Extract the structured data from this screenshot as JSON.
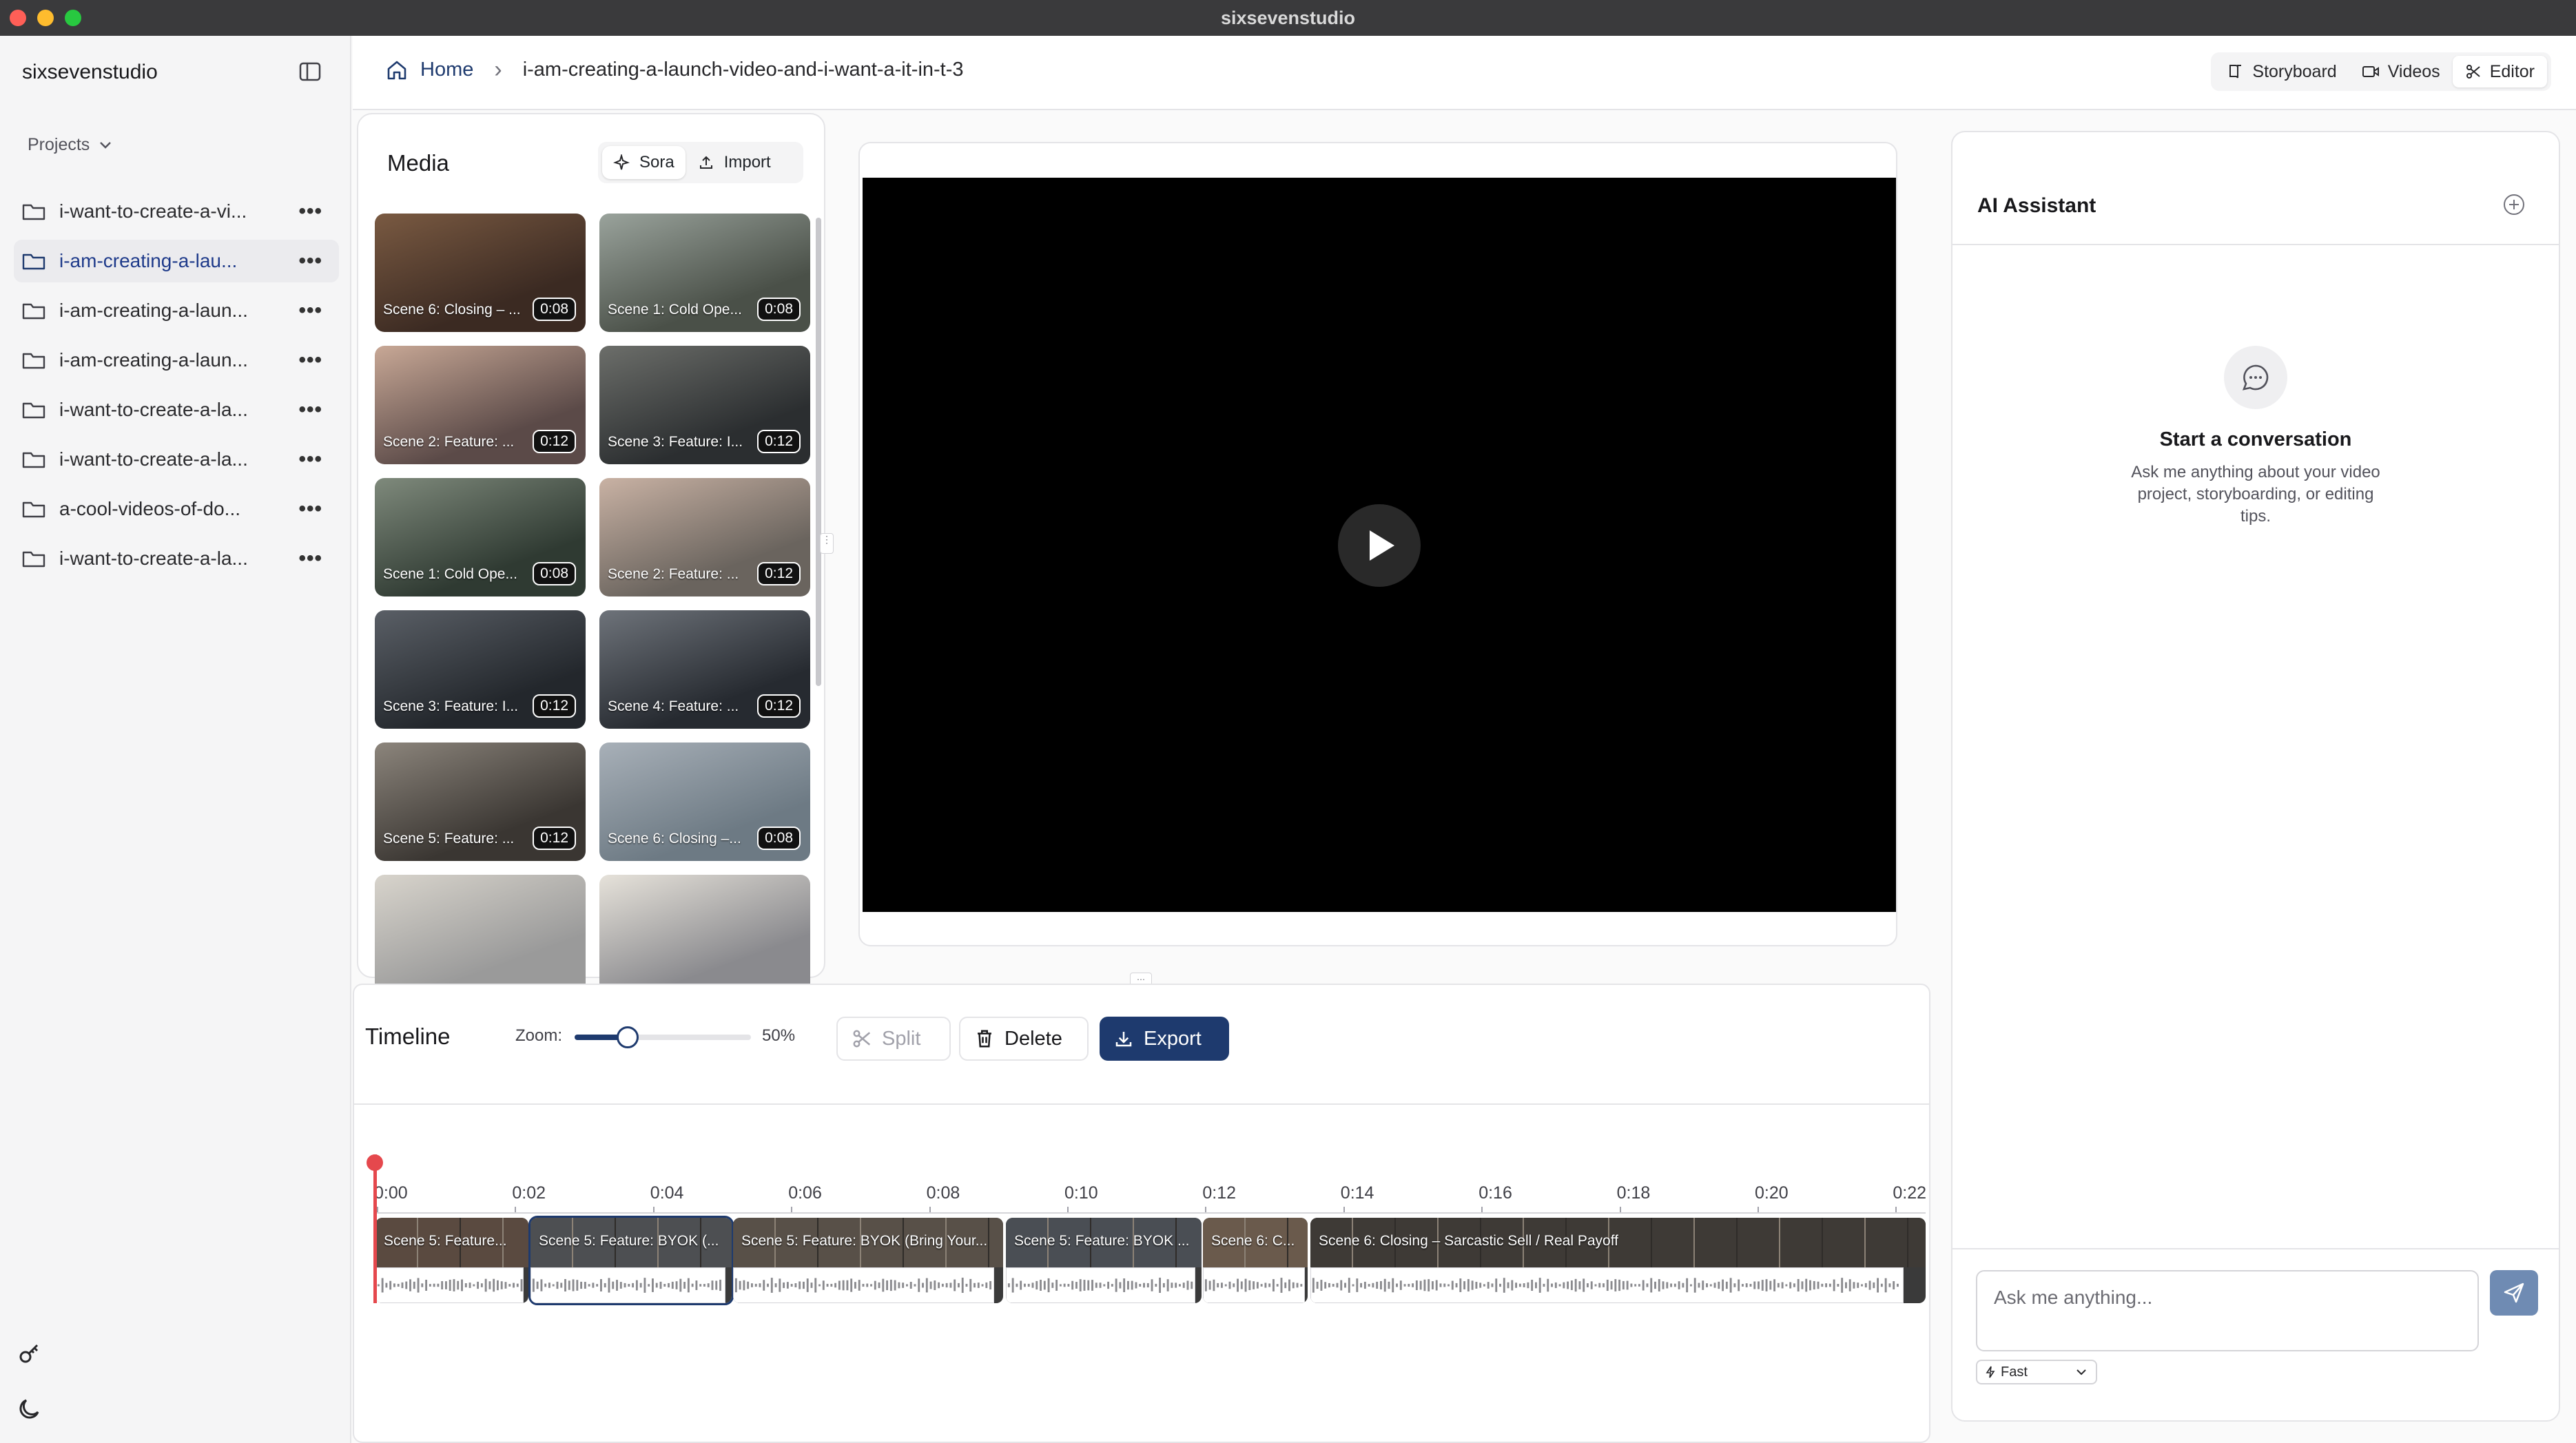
{
  "window": {
    "title": "sixsevenstudio"
  },
  "sidebar": {
    "app_name": "sixsevenstudio",
    "projects_label": "Projects",
    "projects": [
      {
        "label": "i-want-to-create-a-vi...",
        "active": false
      },
      {
        "label": "i-am-creating-a-lau...",
        "active": true
      },
      {
        "label": "i-am-creating-a-laun...",
        "active": false
      },
      {
        "label": "i-am-creating-a-laun...",
        "active": false
      },
      {
        "label": "i-want-to-create-a-la...",
        "active": false
      },
      {
        "label": "i-want-to-create-a-la...",
        "active": false
      },
      {
        "label": "a-cool-videos-of-do...",
        "active": false
      },
      {
        "label": "i-want-to-create-a-la...",
        "active": false
      }
    ],
    "more_glyph": "•••"
  },
  "header": {
    "home": "Home",
    "separator": "›",
    "project": "i-am-creating-a-launch-video-and-i-want-a-it-in-t-3",
    "tabs": [
      {
        "label": "Storyboard",
        "icon": "book-icon"
      },
      {
        "label": "Videos",
        "icon": "video-icon"
      },
      {
        "label": "Editor",
        "icon": "scissors-icon",
        "active": true
      }
    ]
  },
  "media": {
    "title": "Media",
    "sora_label": "Sora",
    "import_label": "Import",
    "clips": [
      {
        "caption": "Scene 6: Closing – ...",
        "duration": "0:08"
      },
      {
        "caption": "Scene 1: Cold Ope...",
        "duration": "0:08"
      },
      {
        "caption": "Scene 2: Feature: ...",
        "duration": "0:12"
      },
      {
        "caption": "Scene 3: Feature: I...",
        "duration": "0:12"
      },
      {
        "caption": "Scene 1: Cold Ope...",
        "duration": "0:08"
      },
      {
        "caption": "Scene 2: Feature: ...",
        "duration": "0:12"
      },
      {
        "caption": "Scene 3: Feature: I...",
        "duration": "0:12"
      },
      {
        "caption": "Scene 4: Feature: ...",
        "duration": "0:12"
      },
      {
        "caption": "Scene 5: Feature: ...",
        "duration": "0:12"
      },
      {
        "caption": "Scene 6: Closing –...",
        "duration": "0:08"
      }
    ]
  },
  "assistant": {
    "title": "AI Assistant",
    "empty_title": "Start a conversation",
    "empty_line1": "Ask me anything about your video",
    "empty_line2": "project, storyboarding, or editing",
    "empty_line3": "tips.",
    "input_placeholder": "Ask me anything...",
    "mode": "Fast"
  },
  "timeline": {
    "title": "Timeline",
    "zoom_label": "Zoom:",
    "zoom_percent": "50%",
    "zoom_value": 0.3,
    "split": "Split",
    "delete": "Delete",
    "export": "Export",
    "ruler": [
      "0:00",
      "0:02",
      "0:04",
      "0:06",
      "0:08",
      "0:10",
      "0:12",
      "0:14",
      "0:16",
      "0:18",
      "0:20",
      "0:22"
    ],
    "clips": [
      {
        "label": "Scene 5: Feature..."
      },
      {
        "label": "Scene 5: Feature: BYOK (..."
      },
      {
        "label": "Scene 5: Feature: BYOK (Bring Your..."
      },
      {
        "label": "Scene 5: Feature: BYOK ..."
      },
      {
        "label": "Scene 6: C..."
      },
      {
        "label": "Scene 6: Closing – Sarcastic Sell / Real Payoff"
      }
    ]
  },
  "colors": {
    "accent": "#1e3a6e",
    "playhead": "#e5484d"
  }
}
